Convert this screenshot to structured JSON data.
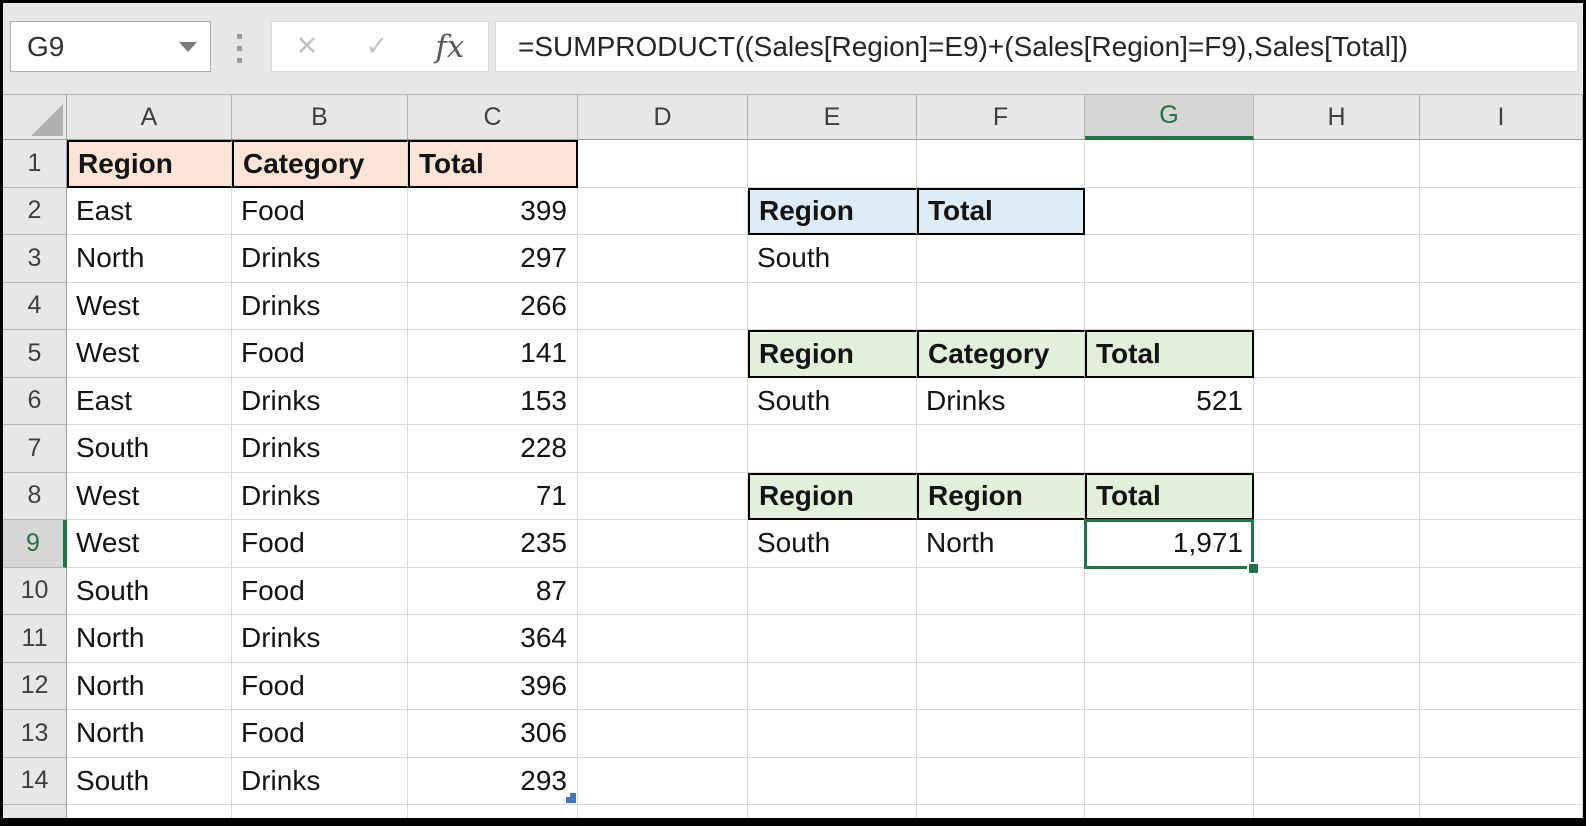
{
  "toolbar": {
    "name_box_value": "G9",
    "formula": "=SUMPRODUCT((Sales[Region]=E9)+(Sales[Region]=F9),Sales[Total])",
    "cancel_icon": "✕",
    "enter_icon": "✓",
    "insert_function_icon": "fx"
  },
  "grid": {
    "column_headers": [
      "A",
      "B",
      "C",
      "D",
      "E",
      "F",
      "G",
      "H",
      "I"
    ],
    "row_numbers": [
      "1",
      "2",
      "3",
      "4",
      "5",
      "6",
      "7",
      "8",
      "9",
      "10",
      "11",
      "12",
      "13",
      "14"
    ],
    "selected_column": "G",
    "selected_row": "9",
    "selected_cell": "G9"
  },
  "sales_table": {
    "start_cell": "A1",
    "header_fill": "#FCE4D6",
    "headers": [
      "Region",
      "Category",
      "Total"
    ],
    "rows": [
      [
        "East",
        "Food",
        "399"
      ],
      [
        "North",
        "Drinks",
        "297"
      ],
      [
        "West",
        "Drinks",
        "266"
      ],
      [
        "West",
        "Food",
        "141"
      ],
      [
        "East",
        "Drinks",
        "153"
      ],
      [
        "South",
        "Drinks",
        "228"
      ],
      [
        "West",
        "Drinks",
        "71"
      ],
      [
        "West",
        "Food",
        "235"
      ],
      [
        "South",
        "Food",
        "87"
      ],
      [
        "North",
        "Drinks",
        "364"
      ],
      [
        "North",
        "Food",
        "396"
      ],
      [
        "North",
        "Food",
        "306"
      ],
      [
        "South",
        "Drinks",
        "293"
      ]
    ]
  },
  "criteria_tables": [
    {
      "start_cell": "E2",
      "header_fill": "#DDEBF7",
      "headers": [
        "Region",
        "Total"
      ],
      "rows": [
        [
          "South",
          ""
        ]
      ]
    },
    {
      "start_cell": "E5",
      "header_fill": "#E2EFDA",
      "headers": [
        "Region",
        "Category",
        "Total"
      ],
      "rows": [
        [
          "South",
          "Drinks",
          "521"
        ]
      ]
    },
    {
      "start_cell": "E8",
      "header_fill": "#E2EFDA",
      "headers": [
        "Region",
        "Region",
        "Total"
      ],
      "rows": [
        [
          "South",
          "North",
          "1,971"
        ]
      ]
    }
  ],
  "colors": {
    "selection_green": "#217346",
    "table_marker_blue": "#4472C4"
  }
}
